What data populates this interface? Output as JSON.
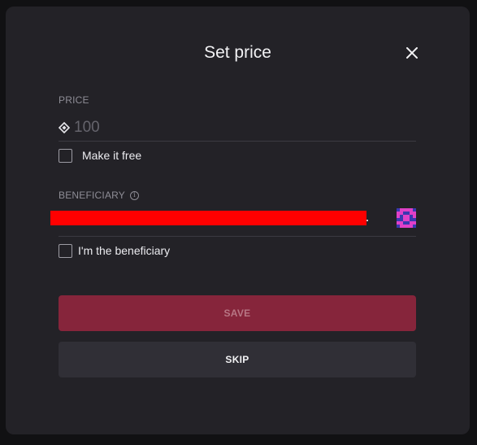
{
  "dialog": {
    "title": "Set price",
    "close_icon": "close-icon"
  },
  "price": {
    "label": "PRICE",
    "currency_icon": "diamond-currency-icon",
    "placeholder": "100",
    "value": ""
  },
  "make_free": {
    "label": "Make it free",
    "checked": false
  },
  "beneficiary": {
    "label": "BENEFICIARY",
    "info_icon": "info-icon",
    "address_redacted": true,
    "address_color": "#ff0000",
    "avatar_icon": "identicon-avatar"
  },
  "im_beneficiary": {
    "label": "I'm the beneficiary",
    "checked": false
  },
  "actions": {
    "save_label": "SAVE",
    "skip_label": "SKIP"
  },
  "colors": {
    "modal_bg": "#232227",
    "page_bg": "#111113",
    "save_bg": "#86253b",
    "skip_bg": "#302f36",
    "avatar_pink": "#e040c8",
    "avatar_blue": "#3a38b0"
  }
}
